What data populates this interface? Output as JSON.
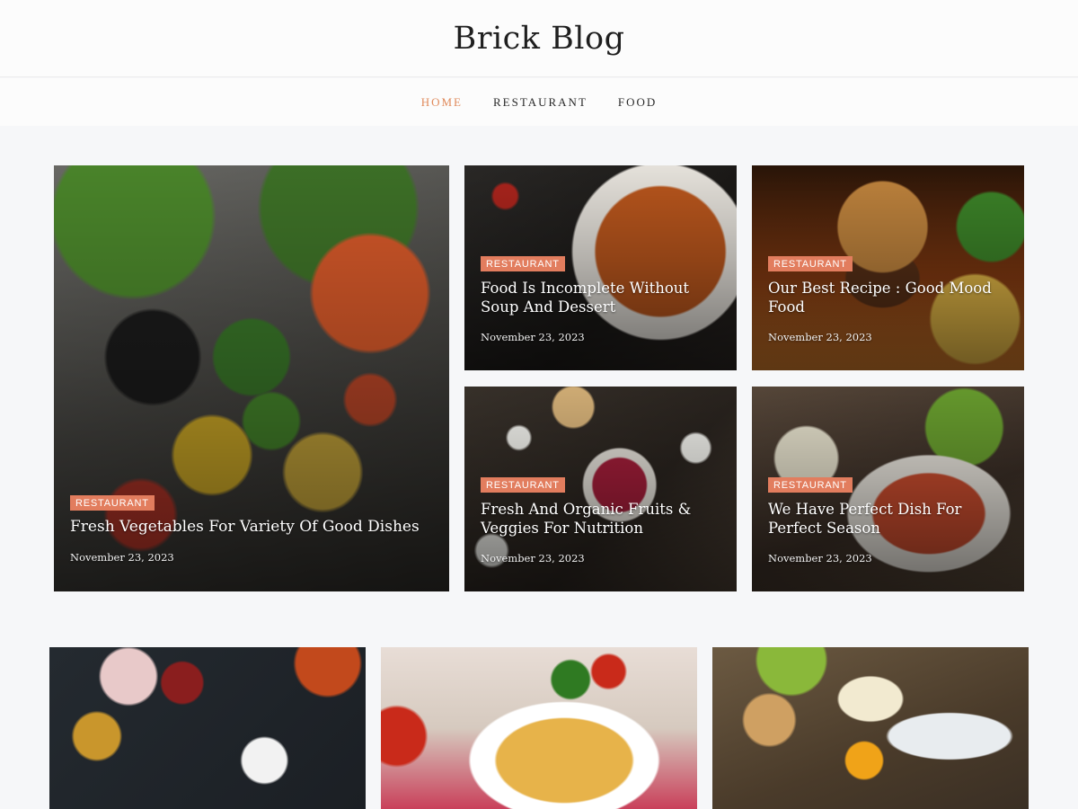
{
  "site": {
    "title": "Brick Blog"
  },
  "nav": [
    {
      "label": "HOME",
      "active": true
    },
    {
      "label": "RESTAURANT",
      "active": false
    },
    {
      "label": "FOOD",
      "active": false
    }
  ],
  "featured": [
    {
      "category": "RESTAURANT",
      "title": "Fresh Vegetables For Variety Of Good Dishes",
      "date": "November 23, 2023",
      "image": "vegetables-image"
    },
    {
      "category": "RESTAURANT",
      "title": "Food Is Incomplete Without Soup And Dessert",
      "date": "November 23, 2023",
      "image": "soup-image"
    },
    {
      "category": "RESTAURANT",
      "title": "Our Best Recipe : Good Mood Food",
      "date": "November 23, 2023",
      "image": "burger-image"
    },
    {
      "category": "RESTAURANT",
      "title": "Fresh And Organic Fruits & Veggies For Nutrition",
      "date": "November 23, 2023",
      "image": "fruits-image"
    },
    {
      "category": "RESTAURANT",
      "title": "We Have Perfect Dish For Perfect Season",
      "date": "November 23, 2023",
      "image": "salad-image"
    }
  ],
  "posts": [
    {
      "image": "spices-image"
    },
    {
      "image": "pasta-image"
    },
    {
      "image": "cheese-image"
    }
  ],
  "colors": {
    "accent": "#e08a5b",
    "badge": "#e27d5e",
    "background": "#f6f7f9"
  }
}
